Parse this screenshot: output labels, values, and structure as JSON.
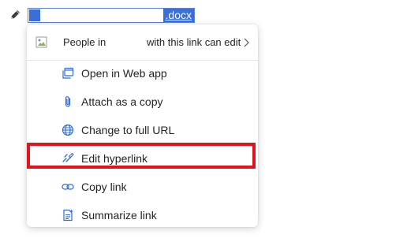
{
  "document": {
    "link_text_visible": ".docx"
  },
  "context_menu": {
    "share_row": {
      "prefix": "People in",
      "suffix": "with this link can edit",
      "thumbnail_icon": "broken-image-icon",
      "chevron_icon": "chevron-right-icon"
    },
    "items": [
      {
        "label": "Open in Web app",
        "icon": "open-window-icon"
      },
      {
        "label": "Attach as a copy",
        "icon": "paperclip-icon"
      },
      {
        "label": "Change to full URL",
        "icon": "globe-icon"
      },
      {
        "label": "Edit hyperlink",
        "icon": "edit-link-icon",
        "highlighted": true
      },
      {
        "label": "Copy link",
        "icon": "link-icon"
      },
      {
        "label": "Summarize link",
        "icon": "summarize-icon"
      }
    ]
  },
  "colors": {
    "selection": "#3a6fd8",
    "icon_blue": "#2f6bd0",
    "highlight_border": "#e3131c",
    "menu_text": "#242424"
  }
}
